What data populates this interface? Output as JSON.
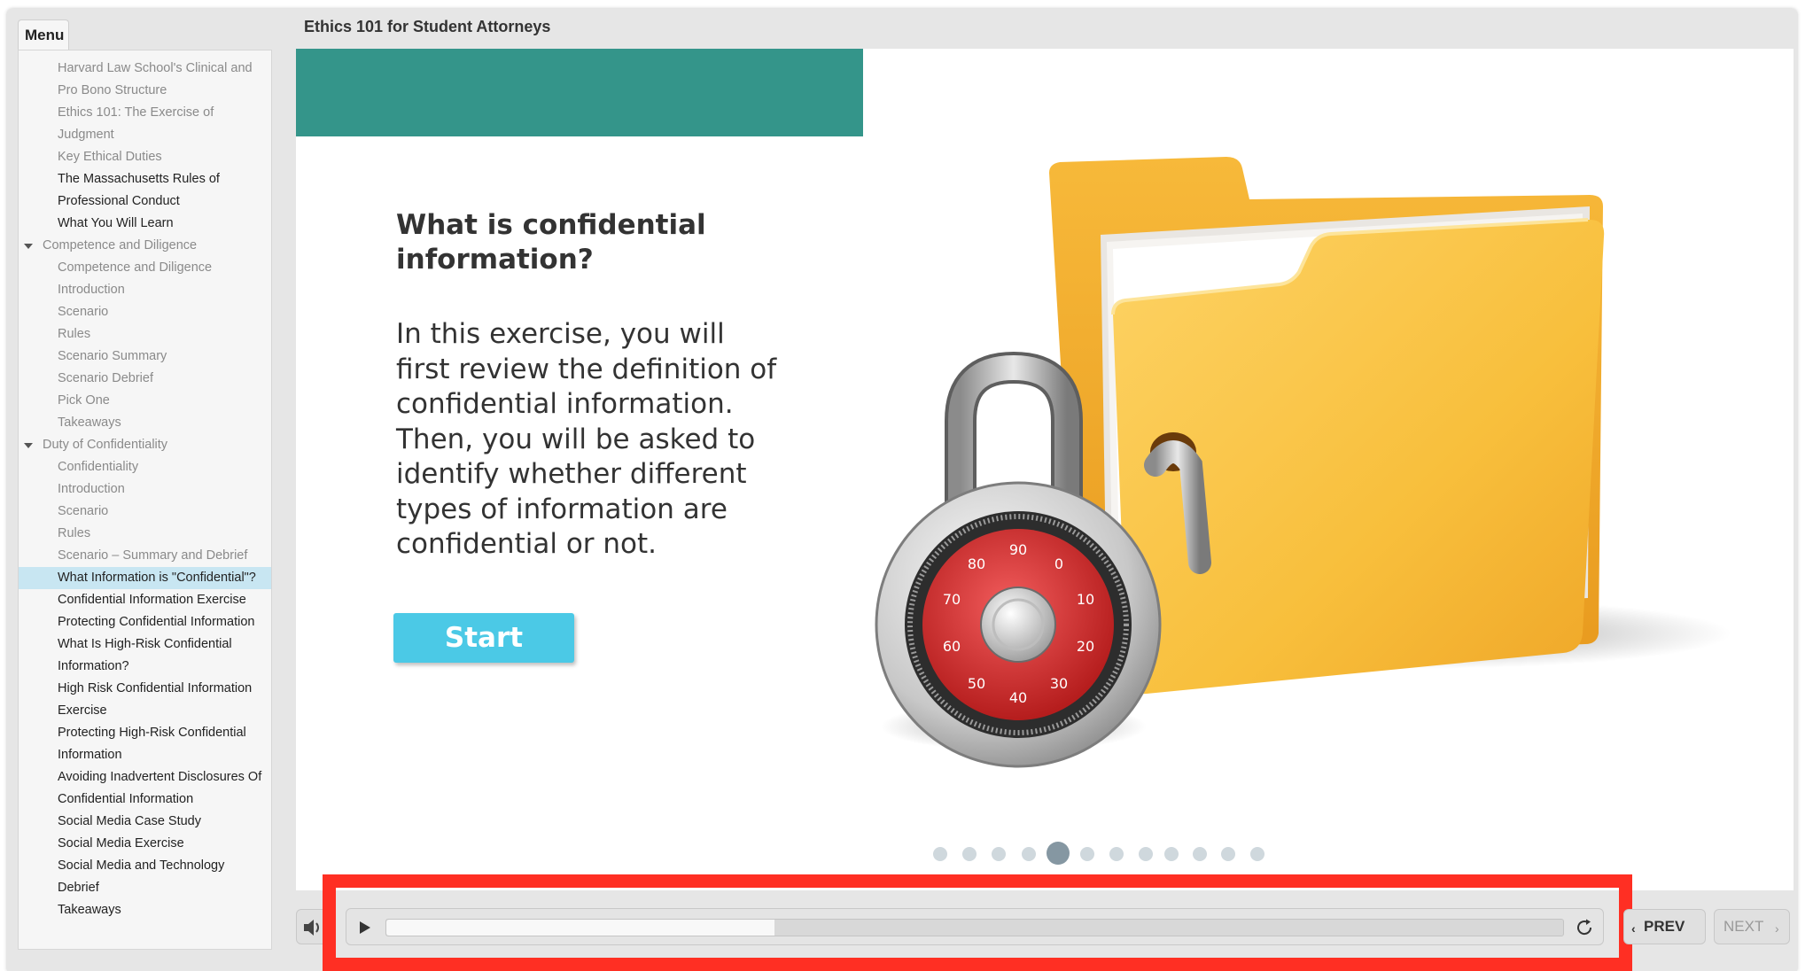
{
  "header": {
    "course_title": "Ethics 101 for Student Attorneys"
  },
  "sidebar": {
    "tab_label": "Menu",
    "items": [
      {
        "label": "Harvard Law School's Clinical and Pro Bono Structure",
        "kind": "visited"
      },
      {
        "label": "Ethics 101: The Exercise of Judgment",
        "kind": "visited"
      },
      {
        "label": "Key Ethical Duties",
        "kind": "visited"
      },
      {
        "label": "The Massachusetts Rules of Professional Conduct",
        "kind": "unvisited"
      },
      {
        "label": "What You Will Learn",
        "kind": "unvisited"
      },
      {
        "label": "Competence and Diligence",
        "kind": "section"
      },
      {
        "label": "Competence and Diligence",
        "kind": "visited"
      },
      {
        "label": "Introduction",
        "kind": "visited"
      },
      {
        "label": "Scenario",
        "kind": "visited"
      },
      {
        "label": "Rules",
        "kind": "visited"
      },
      {
        "label": "Scenario Summary",
        "kind": "visited"
      },
      {
        "label": "Scenario Debrief",
        "kind": "visited"
      },
      {
        "label": "Pick One",
        "kind": "visited"
      },
      {
        "label": "Takeaways",
        "kind": "visited"
      },
      {
        "label": "Duty of Confidentiality",
        "kind": "section"
      },
      {
        "label": "Confidentiality",
        "kind": "visited"
      },
      {
        "label": "Introduction",
        "kind": "visited"
      },
      {
        "label": "Scenario",
        "kind": "visited"
      },
      {
        "label": "Rules",
        "kind": "visited"
      },
      {
        "label": "Scenario – Summary and Debrief",
        "kind": "visited"
      },
      {
        "label": "What Information is \"Confidential\"?",
        "kind": "active"
      },
      {
        "label": "Confidential Information Exercise",
        "kind": "unvisited"
      },
      {
        "label": "Protecting Confidential Information",
        "kind": "unvisited"
      },
      {
        "label": "What Is High-Risk Confidential Information?",
        "kind": "unvisited"
      },
      {
        "label": "High Risk Confidential Information Exercise",
        "kind": "unvisited"
      },
      {
        "label": "Protecting High-Risk Confidential Information",
        "kind": "unvisited"
      },
      {
        "label": "Avoiding Inadvertent Disclosures Of Confidential Information",
        "kind": "unvisited"
      },
      {
        "label": "Social Media Case Study",
        "kind": "unvisited"
      },
      {
        "label": "Social Media Exercise",
        "kind": "unvisited"
      },
      {
        "label": "Social Media and Technology Debrief",
        "kind": "unvisited"
      },
      {
        "label": "Takeaways",
        "kind": "unvisited"
      }
    ]
  },
  "slide": {
    "heading": "What is confidential information?",
    "body": "In this exercise, you will first review the definition of confidential information. Then, you will be asked to identify whether different types of information are confidential or not.",
    "start_label": "Start",
    "accent_color": "#34958a",
    "button_color": "#4bc9e6",
    "lock_dial_numbers": [
      "90",
      "0",
      "10",
      "20",
      "30",
      "40",
      "50",
      "60",
      "70",
      "80"
    ]
  },
  "pagination": {
    "total": 12,
    "current_index": 4
  },
  "controls": {
    "progress": 0.33,
    "prev_label": "PREV",
    "next_label": "NEXT",
    "prev_chevron": "‹",
    "next_chevron": "›",
    "highlight_color": "#ff2f23"
  }
}
